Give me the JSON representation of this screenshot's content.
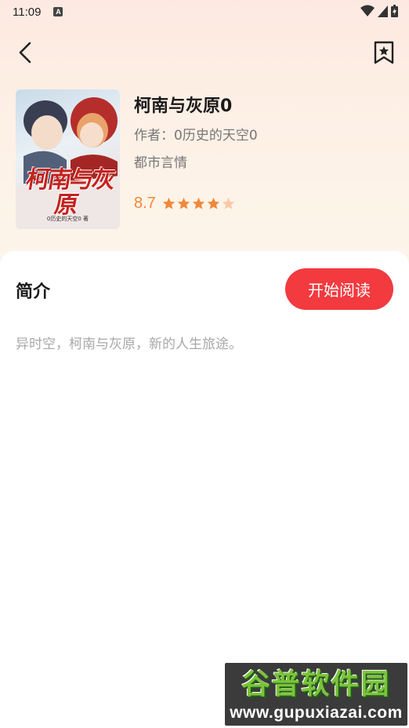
{
  "status_bar": {
    "time": "11:09",
    "notification_badge": "A",
    "icons": [
      "wifi-icon",
      "cellular-icon",
      "battery-charging-icon"
    ]
  },
  "nav": {
    "back_icon": "chevron-left-icon",
    "favorite_icon": "bookmark-star-icon"
  },
  "book": {
    "cover_title": "柯南与灰原",
    "cover_subtitle": "0历史的天空0 著",
    "title": "柯南与灰原0",
    "author": "作者：0历史的天空0",
    "genre": "都市言情",
    "rating": "8.7",
    "stars_filled": 4,
    "stars_total": 5
  },
  "intro": {
    "label": "简介",
    "read_button": "开始阅读",
    "text": "异时空，柯南与灰原，新的人生旅途。"
  },
  "watermark": {
    "title": "谷普软件园",
    "url": "www.gupuxiazai.com"
  },
  "colors": {
    "accent": "#f23a3f",
    "rating": "#f0893a",
    "star_empty": "#f8c9a6"
  }
}
